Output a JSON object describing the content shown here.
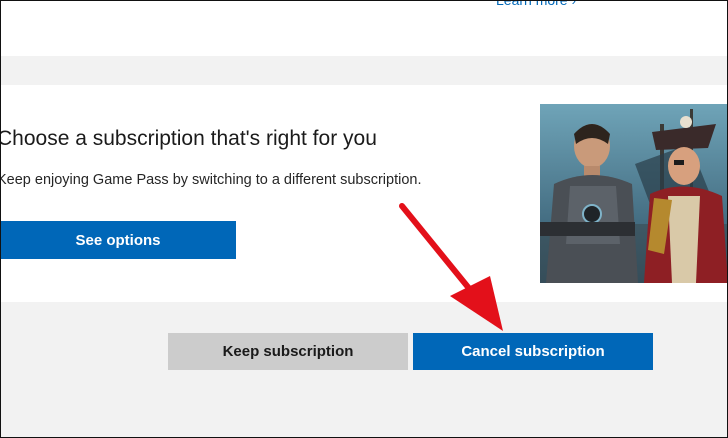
{
  "top_section": {
    "learn_more_label": "Learn more",
    "chevron_icon": "chevron-right-icon"
  },
  "subscription_card": {
    "title": "Choose a subscription that's right for you",
    "description": "Keep enjoying Game Pass by switching to a different subscription.",
    "see_options_label": "See options",
    "promo_image": "game-pass-characters-artwork"
  },
  "actions": {
    "keep_label": "Keep subscription",
    "cancel_label": "Cancel subscription"
  },
  "annotation": {
    "icon": "red-arrow-annotation",
    "color": "#e3101a"
  },
  "colors": {
    "accent": "#0067b8",
    "secondary_button": "#cccccc",
    "page_background": "#f2f2f2",
    "card_background": "#ffffff"
  }
}
